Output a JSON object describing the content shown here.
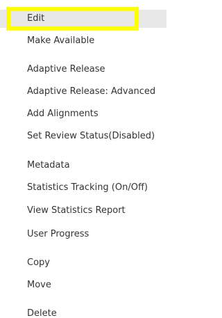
{
  "menu": {
    "items": [
      {
        "label": "Edit"
      },
      {
        "label": "Make Available"
      },
      {
        "label": "Adaptive Release"
      },
      {
        "label": "Adaptive Release: Advanced"
      },
      {
        "label": "Add Alignments"
      },
      {
        "label": "Set Review Status(Disabled)"
      },
      {
        "label": "Metadata"
      },
      {
        "label": "Statistics Tracking (On/Off)"
      },
      {
        "label": "View Statistics Report"
      },
      {
        "label": "User Progress"
      },
      {
        "label": "Copy"
      },
      {
        "label": "Move"
      },
      {
        "label": "Delete"
      }
    ],
    "highlight_color": "#ffff00",
    "hover_color": "#e8e8e8",
    "text_color": "#333333"
  }
}
